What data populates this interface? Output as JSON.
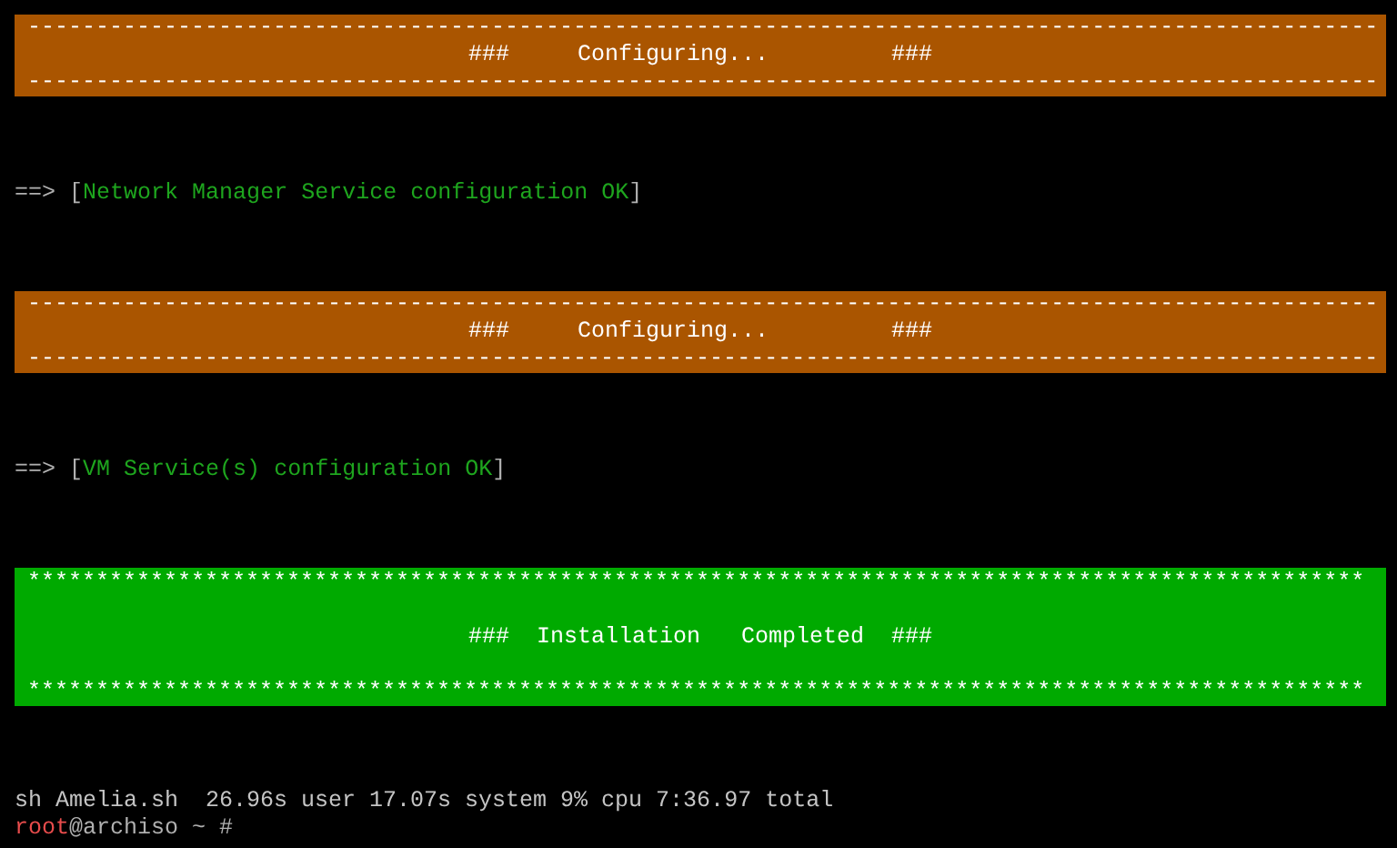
{
  "terminal": {
    "blocks": [
      {
        "kind": "banner",
        "color": "#aa5500",
        "border": "---------------------------------------------------------------------------------------------------",
        "title": "###     Configuring...         ###"
      },
      {
        "kind": "status",
        "arrow": "==>",
        "open": "[",
        "message": "Network Manager Service configuration OK",
        "close": "]"
      },
      {
        "kind": "banner",
        "color": "#aa5500",
        "border": "---------------------------------------------------------------------------------------------------",
        "title": "###     Configuring...         ###"
      },
      {
        "kind": "status",
        "arrow": "==>",
        "open": "[",
        "message": "VM Service(s) configuration OK",
        "close": "]"
      },
      {
        "kind": "tallbanner",
        "color": "#00aa00",
        "border": "**************************************************************************************************",
        "title": "###  Installation   Completed  ###"
      },
      {
        "kind": "output",
        "text": "sh Amelia.sh  26.96s user 17.07s system 9% cpu 7:36.97 total"
      },
      {
        "kind": "prompt",
        "user": "root",
        "rest": "@archiso ~ #"
      }
    ]
  }
}
